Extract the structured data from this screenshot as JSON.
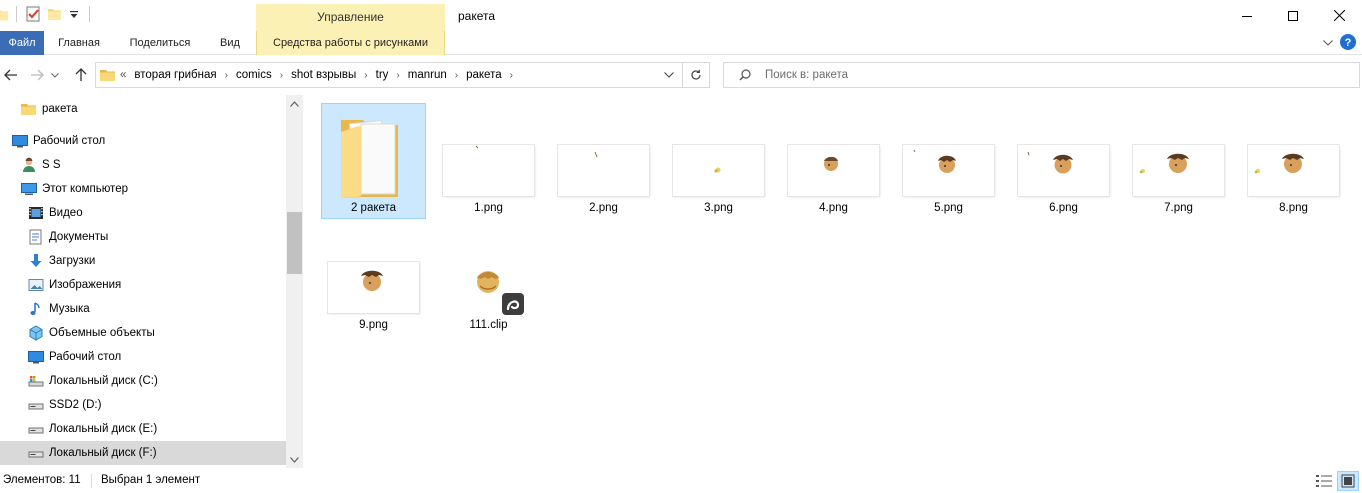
{
  "window": {
    "title": "ракета",
    "context_group": "Управление"
  },
  "ribbon": {
    "tabs": [
      {
        "label": "Файл"
      },
      {
        "label": "Главная"
      },
      {
        "label": "Поделиться"
      },
      {
        "label": "Вид"
      },
      {
        "label": "Средства работы с рисунками"
      }
    ]
  },
  "address": {
    "overflow": "«",
    "breadcrumbs": [
      "вторая грибная",
      "comics",
      "shot взрывы",
      "try",
      "manrun",
      "ракета"
    ]
  },
  "search": {
    "placeholder": "Поиск в: ракета"
  },
  "nav": {
    "items": [
      {
        "label": "ракета",
        "icon": "folder-icon"
      },
      {
        "label": "Рабочий стол",
        "icon": "desktop-icon"
      },
      {
        "label": "S S",
        "icon": "user-icon"
      },
      {
        "label": "Этот компьютер",
        "icon": "computer-icon"
      },
      {
        "label": "Видео",
        "icon": "video-icon"
      },
      {
        "label": "Документы",
        "icon": "documents-icon"
      },
      {
        "label": "Загрузки",
        "icon": "downloads-icon"
      },
      {
        "label": "Изображения",
        "icon": "pictures-icon"
      },
      {
        "label": "Музыка",
        "icon": "music-icon"
      },
      {
        "label": "Объемные объекты",
        "icon": "3d-objects-icon"
      },
      {
        "label": "Рабочий стол",
        "icon": "desktop-icon"
      },
      {
        "label": "Локальный диск (C:)",
        "icon": "drive-c-icon"
      },
      {
        "label": "SSD2 (D:)",
        "icon": "drive-icon"
      },
      {
        "label": "Локальный диск (E:)",
        "icon": "drive-icon"
      },
      {
        "label": "Локальный диск (F:)",
        "icon": "drive-icon"
      }
    ]
  },
  "files": [
    {
      "name": "2 ракета",
      "kind": "folder"
    },
    {
      "name": "1.png",
      "kind": "image"
    },
    {
      "name": "2.png",
      "kind": "image"
    },
    {
      "name": "3.png",
      "kind": "image"
    },
    {
      "name": "4.png",
      "kind": "image"
    },
    {
      "name": "5.png",
      "kind": "image"
    },
    {
      "name": "6.png",
      "kind": "image"
    },
    {
      "name": "7.png",
      "kind": "image"
    },
    {
      "name": "8.png",
      "kind": "image"
    },
    {
      "name": "9.png",
      "kind": "image"
    },
    {
      "name": "111.clip",
      "kind": "clip"
    }
  ],
  "status": {
    "count": "Элементов: 11",
    "selection": "Выбран 1 элемент"
  },
  "colors": {
    "accent": "#3a6db5",
    "context_tab": "#fcf1b5",
    "selection": "#cce8ff"
  }
}
